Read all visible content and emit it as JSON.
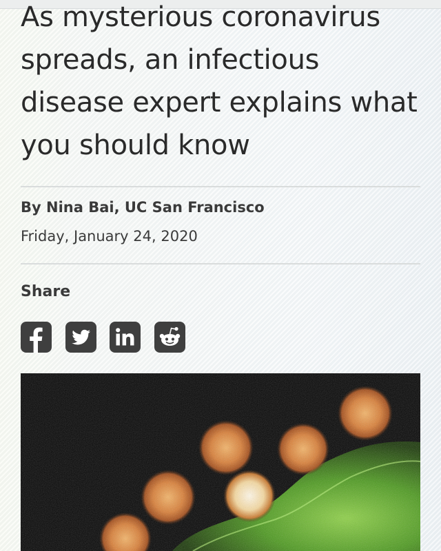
{
  "article": {
    "headline": "As mysterious coronavirus spreads, an infectious disease expert explains what you should know",
    "byline": "By Nina Bai, UC San Francisco",
    "date": "Friday, January 24, 2020"
  },
  "share": {
    "label": "Share",
    "buttons": [
      {
        "network": "facebook",
        "icon": "facebook-icon"
      },
      {
        "network": "twitter",
        "icon": "twitter-icon"
      },
      {
        "network": "linkedin",
        "icon": "linkedin-icon"
      },
      {
        "network": "reddit",
        "icon": "reddit-icon"
      }
    ]
  },
  "hero_image": {
    "subject": "electron micrograph of coronavirus particles"
  },
  "colors": {
    "text": "#2a2a2a",
    "icon_bg": "#3f3f3f",
    "rule": "#d9dcdc",
    "virus_orange": "#e08a3a",
    "cell_green": "#5fae2e"
  }
}
